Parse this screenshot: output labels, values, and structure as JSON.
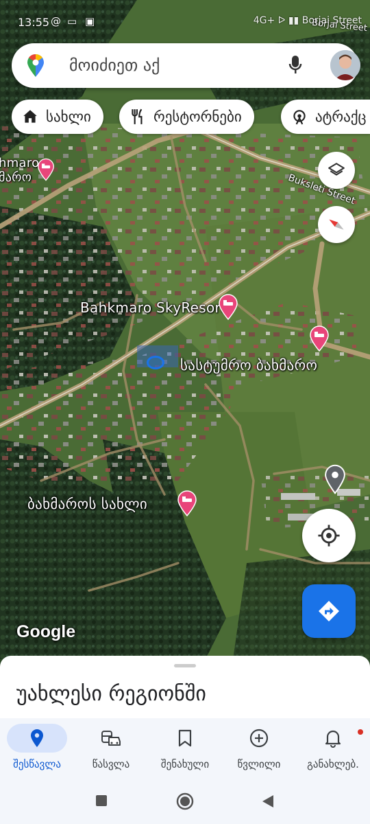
{
  "status_bar": {
    "time": "13:55",
    "right_text": "4G+ ᐅ ▮▮ Borjai Street"
  },
  "search": {
    "placeholder": "მოიძიეთ აქ"
  },
  "chips": [
    {
      "icon": "home-icon",
      "label": "სახლი"
    },
    {
      "icon": "restaurant-icon",
      "label": "რესტორნები"
    },
    {
      "icon": "attractions-icon",
      "label": "ატრაქც"
    }
  ],
  "map": {
    "labels": {
      "skyresort": "Bahkmaro SkyResort",
      "hotel_bakhmaro": "სასტუმრო ბახმარო",
      "bakhmaro_house": "ბახმაროს სახლი",
      "hmaro_top": "hmaro",
      "hmaro_bottom": "მარო",
      "street": "Buksleti Street",
      "corner_street": "Borjai Street"
    },
    "attribution": "Google"
  },
  "sheet": {
    "title": "უახლესი რეგიონში"
  },
  "bottom_nav": [
    {
      "icon": "explore-pin-icon",
      "label": "შესწავლა",
      "active": true
    },
    {
      "icon": "commute-icon",
      "label": "წასვლა",
      "active": false
    },
    {
      "icon": "bookmark-icon",
      "label": "შენახული",
      "active": false
    },
    {
      "icon": "add-circle-icon",
      "label": "წვლილი",
      "active": false
    },
    {
      "icon": "bell-icon",
      "label": "განახლებ.",
      "active": false
    }
  ],
  "colors": {
    "accent": "#1a73e8",
    "pin": "#e8457a",
    "active_nav": "#0b57d0"
  }
}
